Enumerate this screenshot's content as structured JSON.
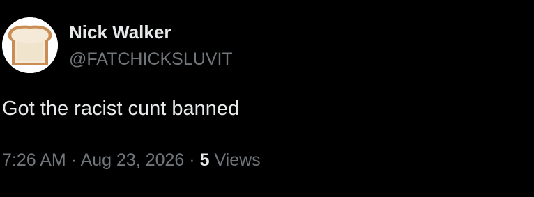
{
  "author": {
    "display_name": "Nick Walker",
    "handle": "@FATCHICKSLUVIT",
    "avatar_icon": "bread-slice-icon"
  },
  "tweet": {
    "text": "Got the racist cunt banned"
  },
  "meta": {
    "time": "7:26 AM",
    "separator_1": "·",
    "date": "Aug 23, 2026",
    "separator_2": "·",
    "view_count": "5",
    "views_label": "Views"
  },
  "colors": {
    "background": "#000000",
    "primary_text": "#e7e9ea",
    "secondary_text": "#71767b",
    "divider": "#2f3336"
  }
}
